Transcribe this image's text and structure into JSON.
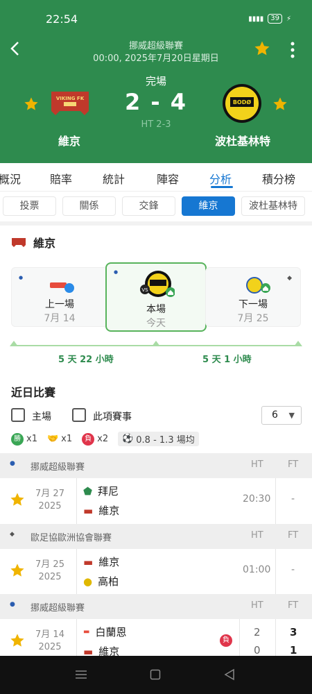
{
  "status_bar": {
    "time": "22:54",
    "signal": "46",
    "battery": "39"
  },
  "header": {
    "league": "挪威超級聯賽",
    "datetime": "00:00, 2025年7月20日星期日",
    "status": "完場",
    "score": "2 - 4",
    "half_time": "HT 2-3",
    "home_team": "維京",
    "away_team": "波杜基林特",
    "home_logo_text": "VIKING FK",
    "away_logo_text": "BODØ"
  },
  "tabs": [
    "概況",
    "賠率",
    "統計",
    "陣容",
    "分析",
    "積分榜"
  ],
  "active_tab": "分析",
  "subtabs": [
    "投票",
    "關係",
    "交鋒",
    "維京",
    "波杜基林特"
  ],
  "active_subtab": "維京",
  "team_section": {
    "team_name": "維京",
    "prev": {
      "label": "上一場",
      "date": "7月 14"
    },
    "current": {
      "label": "本場",
      "date": "今天"
    },
    "next": {
      "label": "下一場",
      "date": "7月 25"
    },
    "gap1": "5 天 22 小時",
    "gap2": "5 天 1 小時"
  },
  "recent": {
    "title": "近日比賽",
    "home_only": "主場",
    "this_comp": "此項賽事",
    "count": "6",
    "wins_badge": "勝",
    "wins": "x1",
    "draws": "x1",
    "losses_badge": "負",
    "losses": "x2",
    "avg_goals": "0.8 - 1.3 場均"
  },
  "groups": [
    {
      "league": "挪威超級聯賽",
      "ht_label": "HT",
      "ft_label": "FT",
      "date": "7月 27",
      "year": "2025",
      "team1": "拜尼",
      "team2": "維京",
      "time": "20:30",
      "result": "-"
    },
    {
      "league": "歐足協歐洲協會聯賽",
      "ht_label": "HT",
      "ft_label": "FT",
      "date": "7月 25",
      "year": "2025",
      "team1": "維京",
      "team2": "高柏",
      "time": "01:00",
      "result": "-"
    },
    {
      "league": "挪威超級聯賽",
      "ht_label": "HT",
      "ft_label": "FT",
      "date": "7月 14",
      "year": "2025",
      "team1": "白蘭恩",
      "team2": "維京",
      "badge": "負",
      "ht1": "2",
      "ht2": "0",
      "ft1": "3",
      "ft2": "1"
    }
  ],
  "colors": {
    "header_green": "#2e8b4e",
    "accent_blue": "#1677d2",
    "star": "#f0b400",
    "loss_red": "#e0354b",
    "win_green": "#3aa655"
  }
}
